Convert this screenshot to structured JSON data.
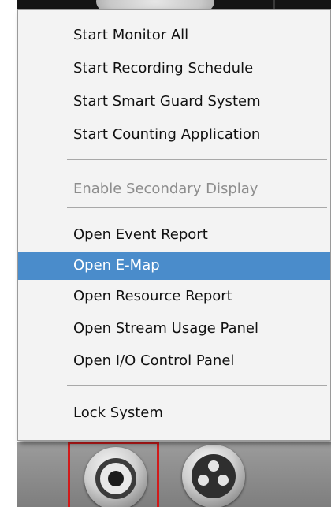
{
  "context_menu": {
    "items": [
      {
        "label": "Start Monitor All"
      },
      {
        "label": "Start Recording Schedule"
      },
      {
        "label": "Start Smart Guard System"
      },
      {
        "label": "Start Counting Application"
      },
      {
        "label": "Enable Secondary Display",
        "state": "disabled"
      },
      {
        "label": "Open Event Report"
      },
      {
        "label": "Open E-Map",
        "state": "highlighted"
      },
      {
        "label": "Open Resource Report"
      },
      {
        "label": "Open Stream Usage Panel"
      },
      {
        "label": "Open I/O Control Panel"
      },
      {
        "label": "Lock System"
      }
    ]
  },
  "toolbar": {
    "buttons": [
      {
        "icon": "record-icon",
        "state": "selected"
      },
      {
        "icon": "film-reel-icon"
      }
    ]
  },
  "colors": {
    "highlight": "#4a8ccb",
    "selection_outline": "#d11a1a",
    "disabled_text": "#8d8d8d"
  }
}
